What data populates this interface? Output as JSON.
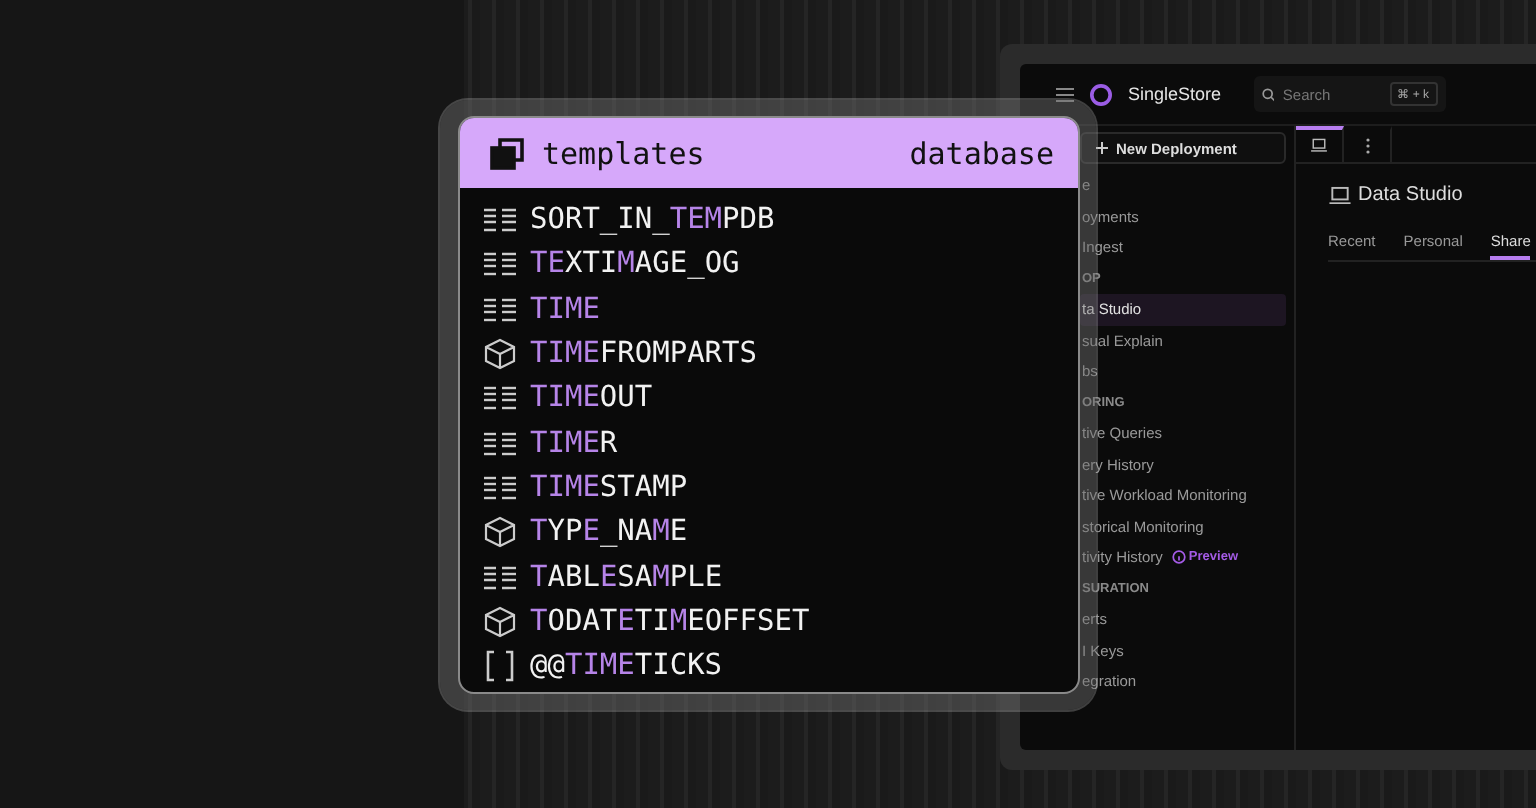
{
  "popup": {
    "header": {
      "title": "templates",
      "type": "database"
    },
    "items": [
      {
        "kind": "table",
        "parts": [
          {
            "text": "SORT_IN_",
            "match": false
          },
          {
            "text": "TEM",
            "match": true
          },
          {
            "text": "PDB",
            "match": false
          }
        ]
      },
      {
        "kind": "table",
        "parts": [
          {
            "text": "TE",
            "match": true
          },
          {
            "text": "XTI",
            "match": false
          },
          {
            "text": "M",
            "match": true
          },
          {
            "text": "AGE_OG",
            "match": false
          }
        ]
      },
      {
        "kind": "table",
        "parts": [
          {
            "text": "TIME",
            "match": true
          }
        ]
      },
      {
        "kind": "function",
        "parts": [
          {
            "text": "TIME",
            "match": true
          },
          {
            "text": "FROMPARTS",
            "match": false
          }
        ]
      },
      {
        "kind": "table",
        "parts": [
          {
            "text": "TIME",
            "match": true
          },
          {
            "text": "OUT",
            "match": false
          }
        ]
      },
      {
        "kind": "table",
        "parts": [
          {
            "text": "TIME",
            "match": true
          },
          {
            "text": "R",
            "match": false
          }
        ]
      },
      {
        "kind": "table",
        "parts": [
          {
            "text": "TIME",
            "match": true
          },
          {
            "text": "STAMP",
            "match": false
          }
        ]
      },
      {
        "kind": "function",
        "parts": [
          {
            "text": "T",
            "match": true
          },
          {
            "text": "YP",
            "match": false
          },
          {
            "text": "E",
            "match": true
          },
          {
            "text": "_NA",
            "match": false
          },
          {
            "text": "M",
            "match": true
          },
          {
            "text": "E",
            "match": false
          }
        ]
      },
      {
        "kind": "table",
        "parts": [
          {
            "text": "T",
            "match": true
          },
          {
            "text": "ABL",
            "match": false
          },
          {
            "text": "E",
            "match": true
          },
          {
            "text": "SA",
            "match": false
          },
          {
            "text": "M",
            "match": true
          },
          {
            "text": "PLE",
            "match": false
          }
        ]
      },
      {
        "kind": "function",
        "parts": [
          {
            "text": "T",
            "match": true
          },
          {
            "text": "ODAT",
            "match": false
          },
          {
            "text": "E",
            "match": true
          },
          {
            "text": "TI",
            "match": false
          },
          {
            "text": "M",
            "match": true
          },
          {
            "text": "EOFFSET",
            "match": false
          }
        ]
      },
      {
        "kind": "variable",
        "parts": [
          {
            "text": "@@",
            "match": false
          },
          {
            "text": "TIME",
            "match": true
          },
          {
            "text": "TICKS",
            "match": false
          }
        ]
      }
    ]
  },
  "app": {
    "brand": "SingleStore",
    "search": {
      "placeholder": "Search",
      "shortcut": "⌘ + k"
    },
    "new_button": "New Deployment",
    "sidebar": [
      {
        "kind": "item",
        "label": "e",
        "selected": false
      },
      {
        "kind": "item",
        "label": "oyments",
        "selected": false
      },
      {
        "kind": "item",
        "label": "Ingest",
        "selected": false
      },
      {
        "kind": "heading",
        "label": "OP",
        "selected": false
      },
      {
        "kind": "item",
        "label": "ta Studio",
        "selected": true
      },
      {
        "kind": "item",
        "label": "sual Explain",
        "selected": false
      },
      {
        "kind": "item",
        "label": "bs",
        "selected": false
      },
      {
        "kind": "heading",
        "label": "ORING",
        "selected": false
      },
      {
        "kind": "item",
        "label": "tive Queries",
        "selected": false
      },
      {
        "kind": "item",
        "label": "ery History",
        "selected": false
      },
      {
        "kind": "item",
        "label": "tive Workload Monitoring",
        "selected": false
      },
      {
        "kind": "item",
        "label": "storical Monitoring",
        "selected": false
      },
      {
        "kind": "item",
        "label": "tivity History",
        "selected": false,
        "badge": "Preview"
      },
      {
        "kind": "heading",
        "label": "SURATION",
        "selected": false
      },
      {
        "kind": "item",
        "label": "erts",
        "selected": false
      },
      {
        "kind": "item",
        "label": "I Keys",
        "selected": false
      },
      {
        "kind": "item",
        "label": "egration",
        "selected": false
      }
    ],
    "title": "Data Studio",
    "tabs": [
      {
        "label": "Recent",
        "selected": false
      },
      {
        "label": "Personal",
        "selected": false
      },
      {
        "label": "Share",
        "selected": true
      }
    ]
  }
}
